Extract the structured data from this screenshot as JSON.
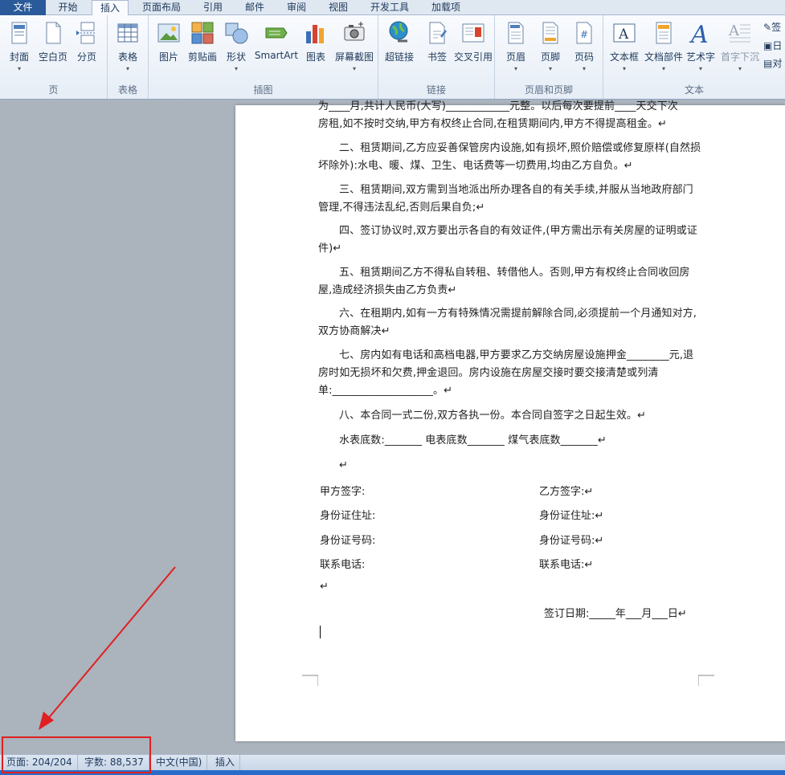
{
  "tabs": [
    "文件",
    "开始",
    "插入",
    "页面布局",
    "引用",
    "邮件",
    "审阅",
    "视图",
    "开发工具",
    "加载项"
  ],
  "active_tab": "插入",
  "groups": {
    "pages": {
      "label": "页",
      "buttons": [
        "封面",
        "空白页",
        "分页"
      ]
    },
    "tables": {
      "label": "表格",
      "buttons": [
        "表格"
      ]
    },
    "illustrations": {
      "label": "插图",
      "buttons": [
        "图片",
        "剪贴画",
        "形状",
        "SmartArt",
        "图表",
        "屏幕截图"
      ]
    },
    "links": {
      "label": "链接",
      "buttons": [
        "超链接",
        "书签",
        "交叉引用"
      ]
    },
    "header_footer": {
      "label": "页眉和页脚",
      "buttons": [
        "页眉",
        "页脚",
        "页码"
      ]
    },
    "text": {
      "label": "文本",
      "buttons": [
        "文本框",
        "文档部件",
        "艺术字",
        "首字下沉"
      ],
      "small_buttons": [
        "签",
        "日",
        "对"
      ]
    }
  },
  "document": {
    "top_partial": "为____月,共计人民币(大写)____________元整。以后每次要提前____天交下次",
    "paragraphs": [
      "房租,如不按时交纳,甲方有权终止合同,在租赁期间内,甲方不得提高租金。↵",
      "二、租赁期间,乙方应妥善保管房内设施,如有损坏,照价赔偿或修复原样(自然损坏除外):水电、暖、煤、卫生、电话费等一切费用,均由乙方自负。↵",
      "三、租赁期间,双方需到当地派出所办理各自的有关手续,并服从当地政府部门管理,不得违法乱纪,否则后果自负;↵",
      "四、签订协议时,双方要出示各自的有效证件,(甲方需出示有关房屋的证明或证件)↵",
      "五、租赁期间乙方不得私自转租、转借他人。否则,甲方有权终止合同收回房屋,造成经济损失由乙方负责↵",
      "六、在租期内,如有一方有特殊情况需提前解除合同,必须提前一个月通知对方,双方协商解决↵",
      "七、房内如有电话和高档电器,甲方要求乙方交纳房屋设施押金________元,退房时如无损坏和欠费,押金退回。房内设施在房屋交接时要交接清楚或列清单:___________________。↵",
      "八、本合同一式二份,双方各执一份。本合同自签字之日起生效。↵",
      "水表底数:_______   电表底数_______   煤气表底数_______↵"
    ],
    "empty_mark": "↵",
    "sign_left": [
      "甲方签字:",
      "身份证住址:",
      "身份证号码:",
      "联系电话:"
    ],
    "sign_right": [
      "乙方签字:↵",
      "身份证住址:↵",
      "身份证号码:↵",
      "联系电话:↵"
    ],
    "date_line": "签订日期:_____年___月___日↵"
  },
  "status": {
    "page": "页面: 204/204",
    "words": "字数: 88,537",
    "language": "中文(中国)",
    "mode": "插入"
  },
  "annotation_color": "#e02020"
}
